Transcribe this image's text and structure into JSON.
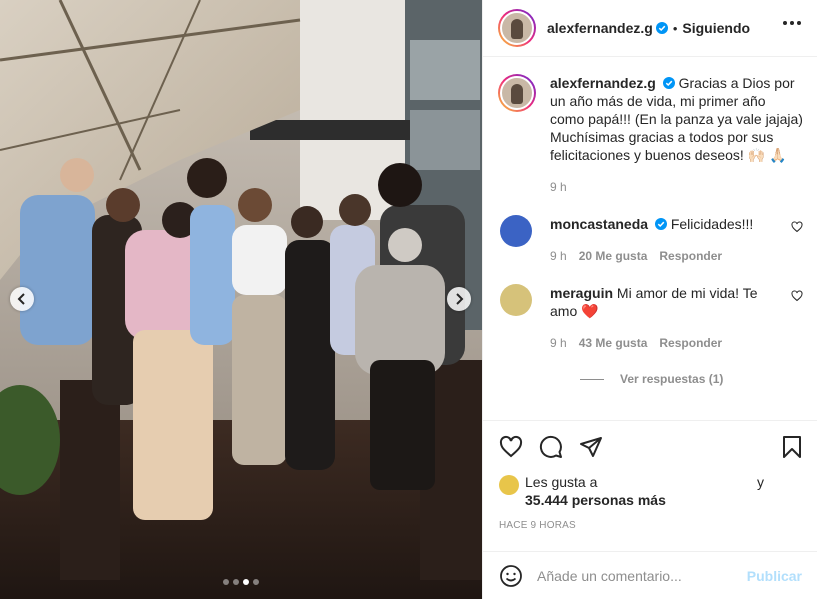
{
  "post": {
    "username": "alexfernandez.g",
    "separator": "•",
    "follow_state": "Siguiendo",
    "caption": "Gracias a Dios por un año más de vida, mi primer año como papá!!! (En la panza ya vale jajaja) Muchísimas gracias a todos por sus felicitaciones y buenos deseos! 🙌🏻 🙏🏻",
    "caption_time": "9 h"
  },
  "comments": [
    {
      "username": "moncastaneda",
      "verified": true,
      "text": "Felicidades!!!",
      "time": "9 h",
      "likes": "20 Me gusta",
      "reply": "Responder",
      "avatar_color": "#3b63c4"
    },
    {
      "username": "meraguin",
      "verified": false,
      "text": "Mi amor de mi vida! Te amo",
      "emoji": "❤️",
      "time": "9 h",
      "likes": "43 Me gusta",
      "reply": "Responder",
      "avatar_color": "#d6c27a"
    }
  ],
  "replies_label": "Ver respuestas (1)",
  "likes": {
    "prefix": "Les gusta a",
    "and": "y",
    "count_text": "35.444 personas más"
  },
  "time_ago": "HACE 9 HORAS",
  "add_comment": {
    "placeholder": "Añade un comentario...",
    "publish": "Publicar"
  },
  "carousel": {
    "total": 4,
    "active": 3
  },
  "colors": {
    "verified": "#0095f6",
    "publish_disabled": "#b2dffc",
    "muted": "#8e8e8e"
  }
}
